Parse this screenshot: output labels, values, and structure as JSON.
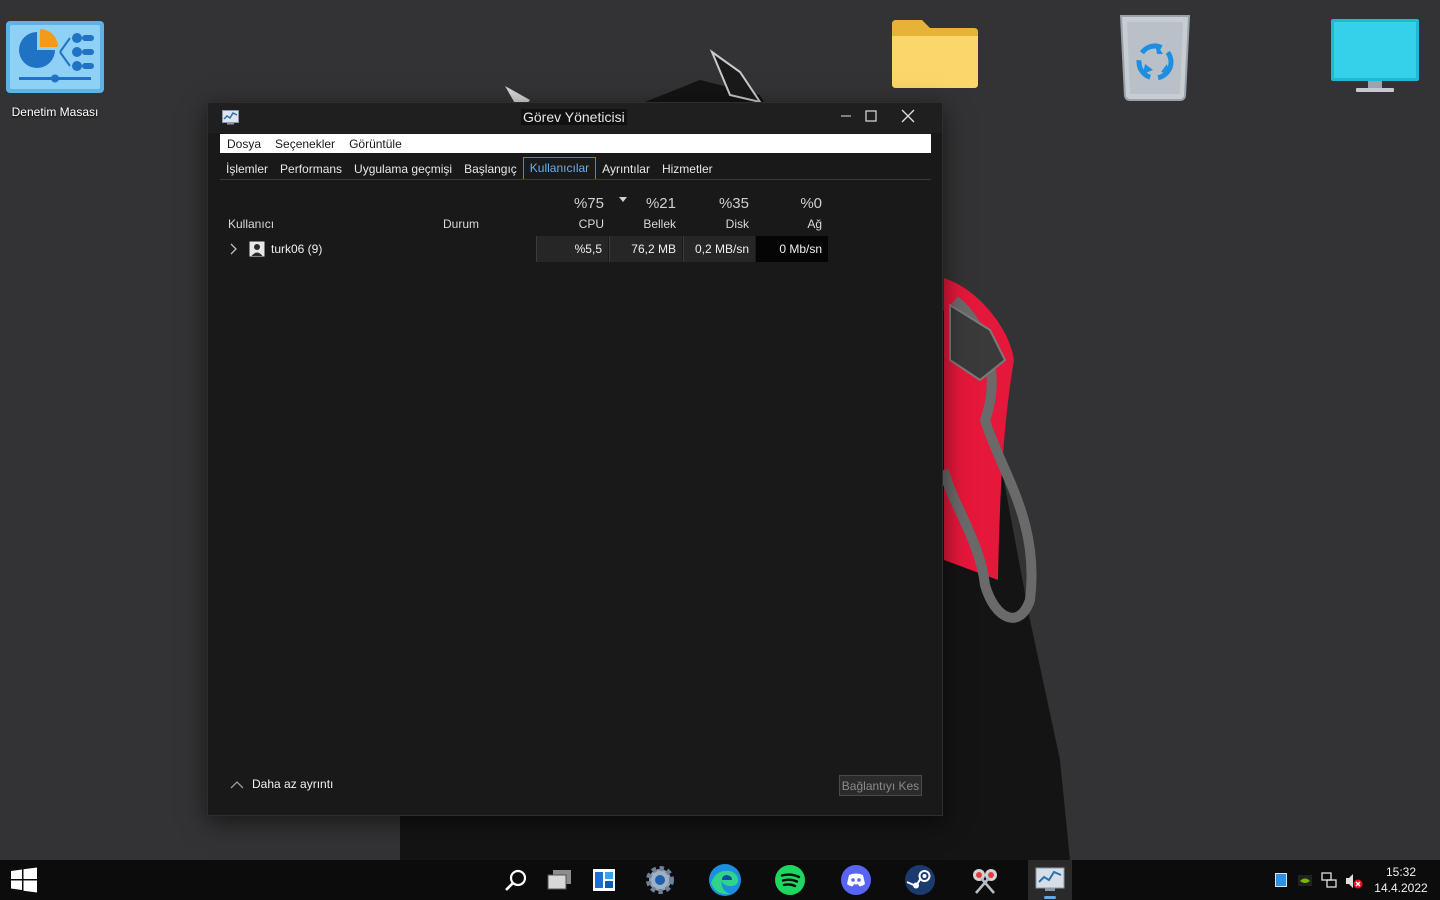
{
  "desktop": {
    "control_panel_label": "Denetim Masası"
  },
  "window": {
    "title": "Görev Yöneticisi",
    "menu": [
      "Dosya",
      "Seçenekler",
      "Görüntüle"
    ],
    "tabs": [
      "İşlemler",
      "Performans",
      "Uygulama geçmişi",
      "Başlangıç",
      "Kullanıcılar",
      "Ayrıntılar",
      "Hizmetler"
    ],
    "active_tab": "Kullanıcılar",
    "columns": {
      "user": "Kullanıcı",
      "status": "Durum",
      "cpu": {
        "pct": "%75",
        "label": "CPU"
      },
      "memory": {
        "pct": "%21",
        "label": "Bellek"
      },
      "disk": {
        "pct": "%35",
        "label": "Disk"
      },
      "network": {
        "pct": "%0",
        "label": "Ağ"
      }
    },
    "row": {
      "name": "turk06 (9)",
      "status": "",
      "cpu": "%5,5",
      "memory": "76,2 MB",
      "disk": "0,2 MB/sn",
      "network": "0 Mb/sn"
    },
    "fewer_details": "Daha az ayrıntı",
    "disconnect": "Bağlantıyı Kes"
  },
  "taskbar": {
    "time": "15:32",
    "date": "14.4.2022"
  },
  "colors": {
    "accent": "#3a8ad8",
    "wallpaper_red": "#e5173a",
    "window_bg": "#191919"
  }
}
